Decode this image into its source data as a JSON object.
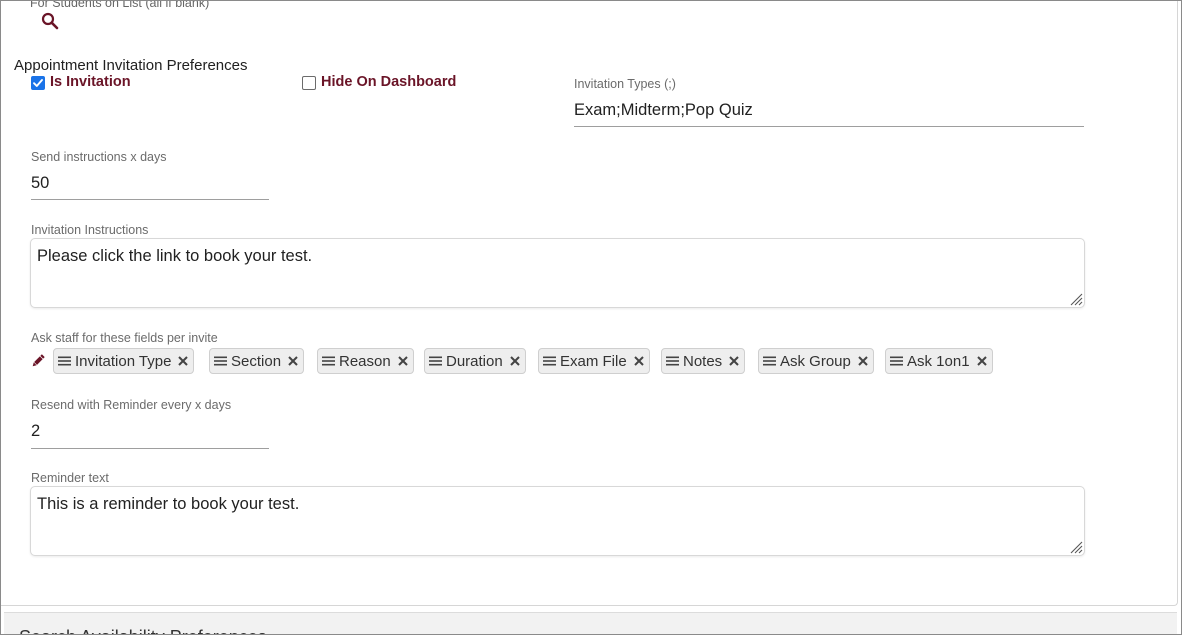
{
  "students_filter": {
    "label": "For Students on List (all if blank)",
    "search_icon": "search-icon",
    "icon_color": "#6a1427"
  },
  "invitation_prefs": {
    "section_title": "Appointment Invitation Preferences",
    "is_invitation": {
      "label": "Is Invitation",
      "checked": true
    },
    "hide_on_dashboard": {
      "label": "Hide On Dashboard",
      "checked": false
    },
    "invitation_types": {
      "label": "Invitation Types (;)",
      "value": "Exam;Midterm;Pop Quiz"
    },
    "send_instructions": {
      "label": "Send instructions x days",
      "value": "50"
    },
    "invitation_instructions": {
      "label": "Invitation Instructions",
      "value": "Please click the link to book your test."
    },
    "ask_staff": {
      "label": "Ask staff for these fields per invite",
      "edit_icon": "pencil-icon",
      "fields": [
        "Invitation Type",
        "Section",
        "Reason",
        "Duration",
        "Exam File",
        "Notes",
        "Ask Group",
        "Ask 1on1"
      ]
    },
    "resend_reminder": {
      "label": "Resend with Reminder every x days",
      "value": "2"
    },
    "reminder_text": {
      "label": "Reminder text",
      "value": "This is a reminder to book your test."
    }
  },
  "next_section": {
    "title": "Search Availability Preferences"
  },
  "colors": {
    "accent": "#6a1427",
    "checkbox_checked": "#1a73e8",
    "chip_background": "#eeeeee"
  }
}
